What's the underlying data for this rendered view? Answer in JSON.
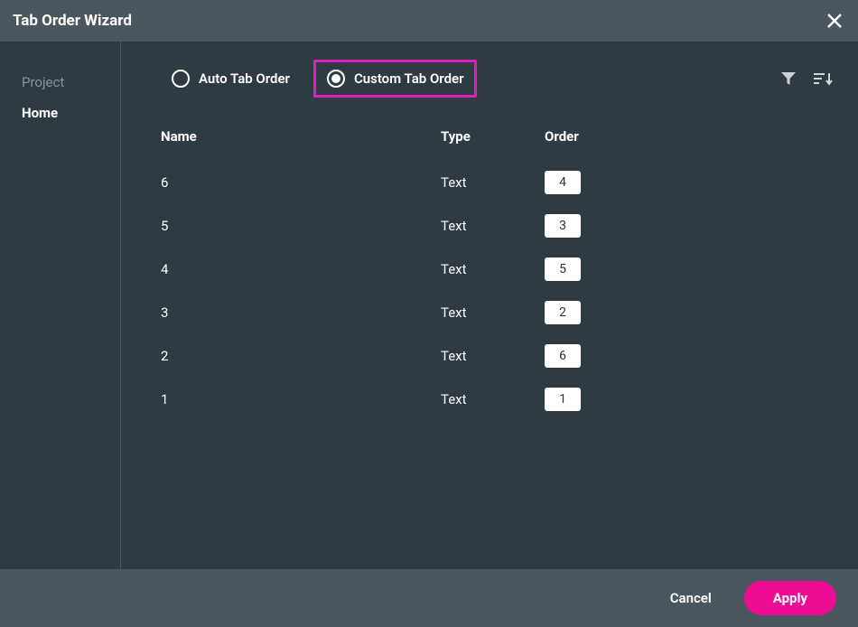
{
  "title": "Tab Order Wizard",
  "sidebar": {
    "items": [
      {
        "label": "Project",
        "active": false
      },
      {
        "label": "Home",
        "active": true
      }
    ]
  },
  "mode": {
    "options": [
      {
        "id": "auto",
        "label": "Auto Tab Order",
        "selected": false,
        "highlight": false
      },
      {
        "id": "custom",
        "label": "Custom Tab Order",
        "selected": true,
        "highlight": true
      }
    ]
  },
  "columns": {
    "name": "Name",
    "type": "Type",
    "order": "Order"
  },
  "rows": [
    {
      "name": "6",
      "type": "Text",
      "order": "4"
    },
    {
      "name": "5",
      "type": "Text",
      "order": "3"
    },
    {
      "name": "4",
      "type": "Text",
      "order": "5"
    },
    {
      "name": "3",
      "type": "Text",
      "order": "2"
    },
    {
      "name": "2",
      "type": "Text",
      "order": "6"
    },
    {
      "name": "1",
      "type": "Text",
      "order": "1"
    }
  ],
  "footer": {
    "cancel": "Cancel",
    "apply": "Apply"
  }
}
